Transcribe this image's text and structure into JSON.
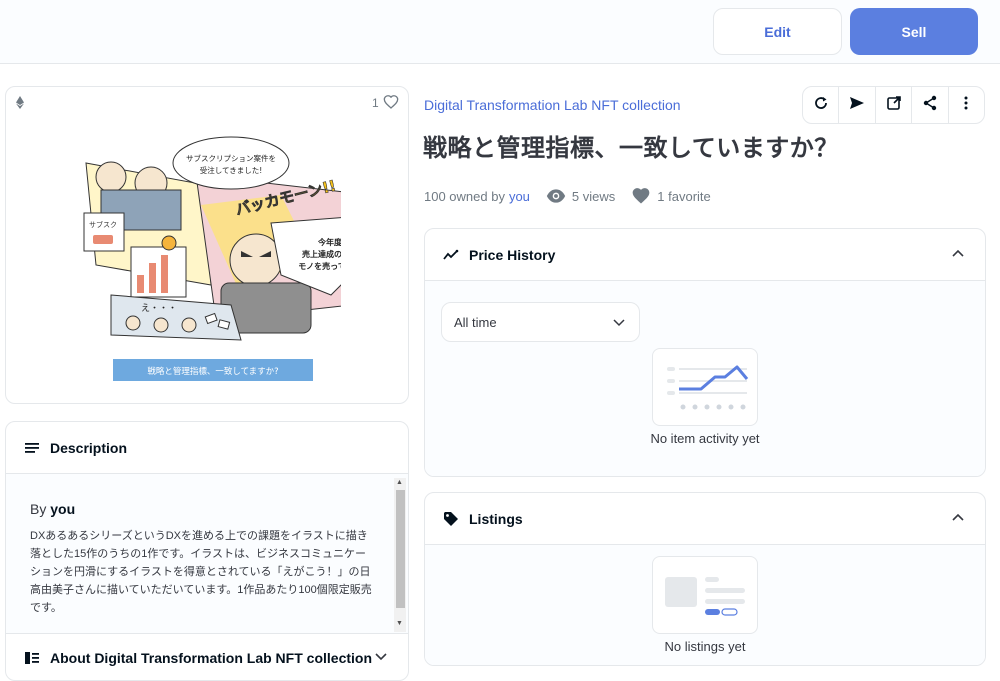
{
  "topbar": {
    "edit_label": "Edit",
    "sell_label": "Sell"
  },
  "media": {
    "favorite_count": "1",
    "art": {
      "bubble1": "サブスクリプション案件を",
      "bubble1b": "受注してきました!",
      "shout": "バッカモーン!!",
      "bubble2a": "今年度の",
      "bubble2b": "売上達成のために",
      "bubble2c": "モノを売ってこーい",
      "sign": "サブスク",
      "murmur": "え・・・",
      "caption": "戦略と管理指標、一致してますか?"
    }
  },
  "description": {
    "heading": "Description",
    "by_prefix": "By",
    "by_user": "you",
    "text": "DXあるあるシリーズというDXを進める上での課題をイラストに描き落とした15作のうちの1作です。イラストは、ビジネスコミュニケーションを円滑にするイラストを得意とされている「えがこう！」の日高由美子さんに描いていただいています。1作品あたり100個限定販売です。",
    "about_heading": "About Digital Transformation Lab NFT collection"
  },
  "item": {
    "collection": "Digital Transformation Lab NFT collection",
    "title": "戦略と管理指標、一致していますか？",
    "owned_prefix": "100 owned by",
    "owned_by": "you",
    "views": "5 views",
    "favorites": "1 favorite"
  },
  "price_history": {
    "heading": "Price History",
    "select_value": "All time",
    "empty_text": "No item activity yet"
  },
  "listings": {
    "heading": "Listings",
    "empty_text": "No listings yet"
  },
  "colors": {
    "accent": "#5b7fe0",
    "link": "#4a6dd8",
    "border": "#e5e8eb"
  }
}
